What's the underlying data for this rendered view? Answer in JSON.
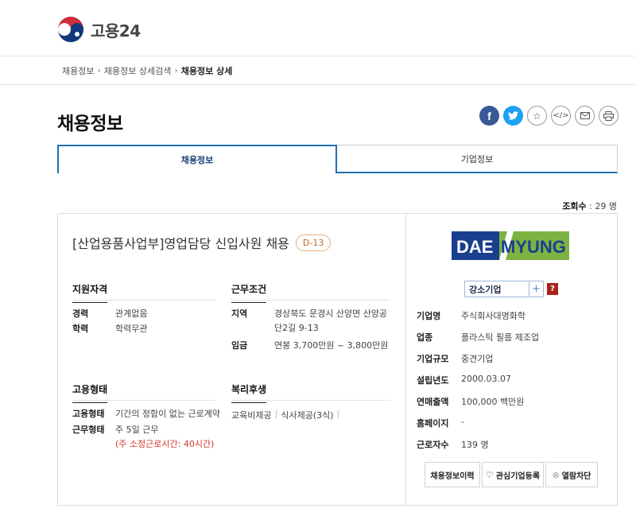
{
  "header": {
    "logo_text": "고용24"
  },
  "breadcrumb": [
    "채용정보",
    "채용정보 상세검색",
    "채용정보 상세"
  ],
  "page_title": "채용정보",
  "share": [
    "facebook-icon",
    "twitter-icon",
    "star-icon",
    "code-icon",
    "mail-icon",
    "print-icon"
  ],
  "tabs": [
    {
      "label": "채용정보",
      "active": true
    },
    {
      "label": "기업정보",
      "active": false
    }
  ],
  "views": {
    "label": "조회수",
    "value": ": 29 명"
  },
  "job": {
    "title": "[산업용품사업부]영업담당 신입사원 채용",
    "dday": "D-13",
    "qualification": {
      "heading": "지원자격",
      "career_k": "경력",
      "career_v": "관계없음",
      "edu_k": "학력",
      "edu_v": "학력무관"
    },
    "conditions": {
      "heading": "근무조건",
      "region_k": "지역",
      "region_v1": "경상북도 문경시 산양면 산양공",
      "region_v2": "단2길 9-13",
      "wage_k": "임금",
      "wage_v": "연봉 3,700만원 ~ 3,800만원"
    },
    "employment": {
      "heading": "고용형태",
      "type_k": "고용형태",
      "type_v": "기간의 정함이 없는 근로계약",
      "shape_k": "근무형태",
      "shape_v": "주 5일 근무",
      "hours_note": "(주 소정근로시간: 40시간)"
    },
    "welfare": {
      "heading": "복리후생",
      "items": [
        "교육비제공",
        "식사제공(3식)"
      ]
    }
  },
  "company": {
    "logo_text_left": "DAE",
    "logo_text_right": "MYUNG",
    "badge": "강소기업",
    "badge_plus": "+",
    "help": "?",
    "rows": [
      {
        "k": "기업명",
        "v": "주식회사대명화학"
      },
      {
        "k": "업종",
        "v": "플라스틱 필름 제조업"
      },
      {
        "k": "기업규모",
        "v": "중견기업"
      },
      {
        "k": "설립년도",
        "v": "2000.03.07"
      },
      {
        "k": "연매출액",
        "v": "100,000 백만원"
      },
      {
        "k": "홈페이지",
        "v": "-"
      },
      {
        "k": "근로자수",
        "v": "139 명"
      }
    ],
    "buttons": {
      "history": "채용정보이력",
      "interest": "관심기업등록",
      "block": "열람차단"
    }
  },
  "colors": {
    "accent": "#1e6fae",
    "dday": "#c5671b",
    "help": "#a8231c",
    "logo_blue": "#1b3f8f",
    "logo_green": "#7cb342"
  }
}
